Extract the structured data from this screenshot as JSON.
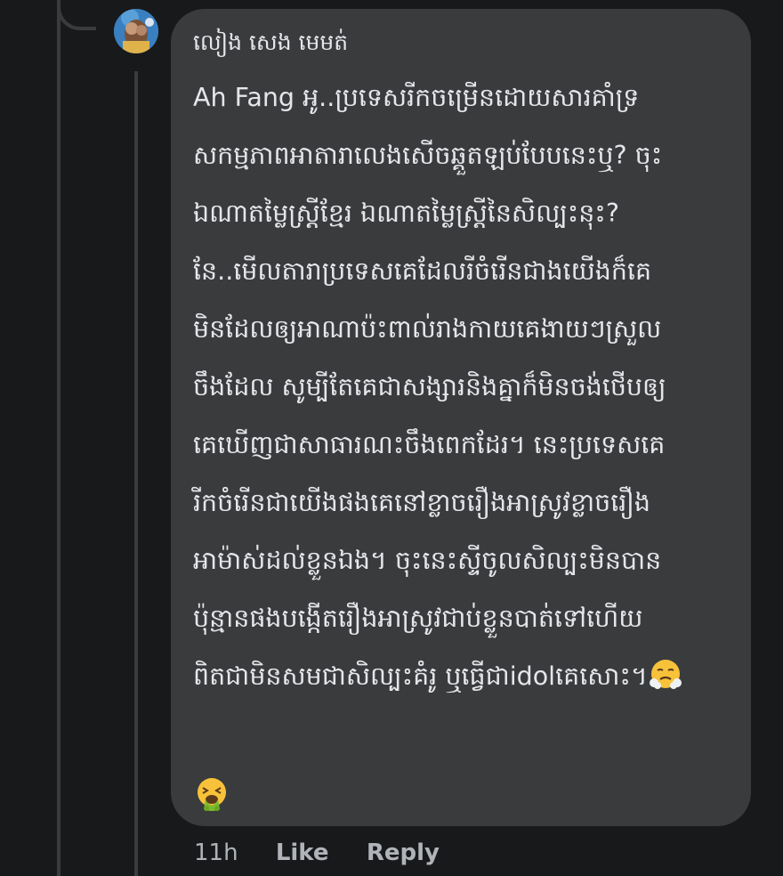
{
  "comment": {
    "author": "លៀង សេង មេមត់",
    "mention": "Ah Fang",
    "lines": [
      " អូ..ប្រទេសរីកចម្រើនដោយសារគាំទ្រ",
      "សកម្មភាពអាតារាលេងសើចឆ្គួតឡប់បែបនេះឬ? ចុះ",
      "ឯណាតម្លៃស្រ្តីខ្មែរ ឯណាតម្លៃស្រ្តីនៃសិល្បះនុះ?",
      "នែ..មើលតារាប្រទេសគេដែលរីចំរើនជាងយើងក៏គេ",
      "មិនដែលឲ្យអាណាប៉ះពាល់រាងកាយគេងាយៗស្រួល",
      "ចឹងដែល សូម្បីតែគេជាសង្សារនិងគ្នាក៏មិនចង់ថើបឲ្យ",
      "គេឃើញជាសាធារណះចឹងពេកដែរ។ នេះប្រទេសគេ",
      "រីកចំរើនជាយើងផងគេនៅខ្លាចរឿងអាស្រូវខ្លាចរឿង",
      "អាម៉ាស់ដល់ខ្លួនឯង។ ចុះនេះស្ទីចូលសិល្បះមិនបាន",
      "ប៉ុន្មានផងបង្កើតរឿងអាស្រូវជាប់ខ្លួនបាត់ទៅហើយ",
      "ពិតជាមិនសមជាសិល្បះគំរូ ឬធ្វើជាidolគេសោះ។"
    ],
    "emoji_inline": "face-with-steam-from-nose-emoji",
    "emoji_trailing": "face-vomiting-emoji"
  },
  "actions": {
    "time": "11h",
    "like_label": "Like",
    "reply_label": "Reply"
  },
  "colors": {
    "background": "#18191a",
    "bubble": "#3a3b3c",
    "text": "#e4e6eb",
    "secondary_text": "#b0b3b8",
    "thread_line": "#3a3b3c"
  }
}
